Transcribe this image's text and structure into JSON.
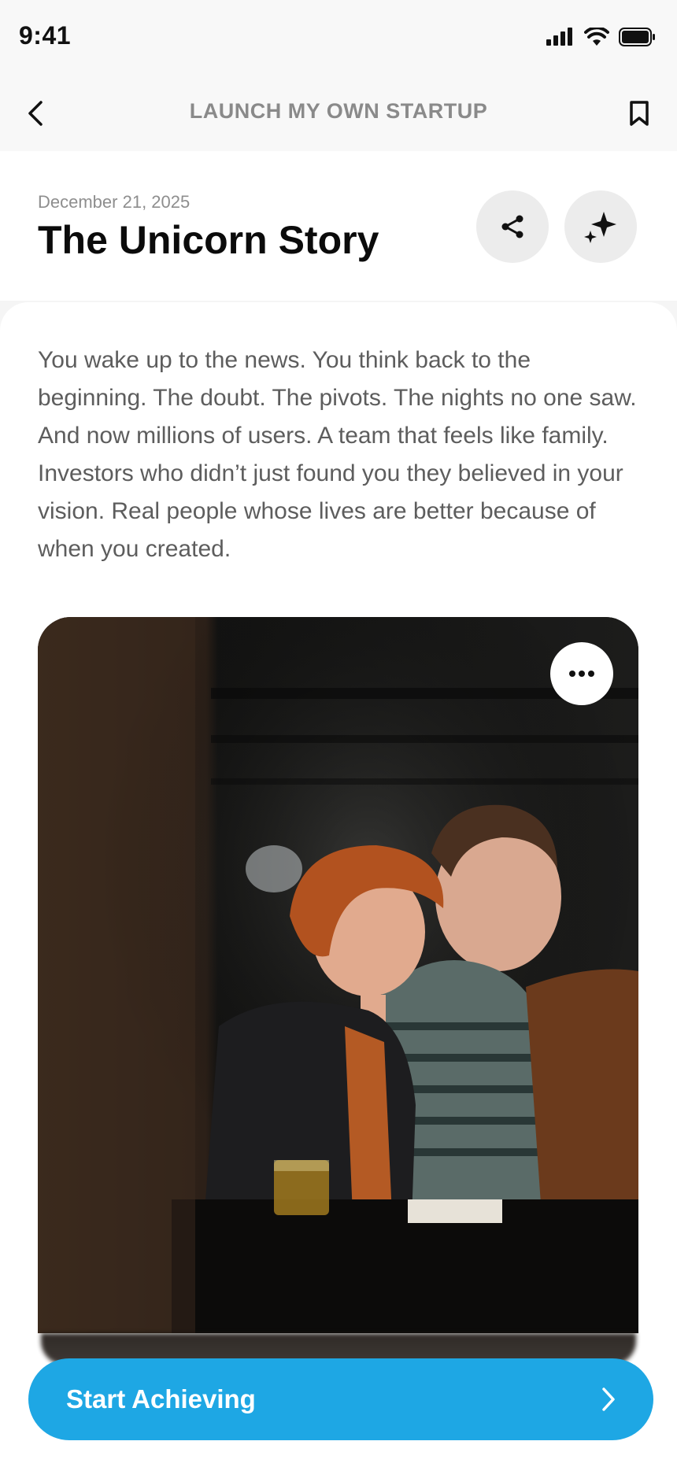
{
  "status_bar": {
    "time": "9:41",
    "icons": [
      "cellular-signal-icon",
      "wifi-icon",
      "battery-icon"
    ]
  },
  "nav": {
    "title": "LAUNCH MY OWN STARTUP",
    "back_icon": "chevron-left-icon",
    "bookmark_icon": "bookmark-icon"
  },
  "article": {
    "date": "December 21, 2025",
    "title": "The Unicorn Story",
    "actions": [
      "share-icon",
      "sparkle-icon"
    ],
    "body": "You wake up to the news. You think back to the beginning. The doubt. The pivots. The nights no one saw. And now millions of users. A team that feels like family. Investors who didn’t just found you they believed in your vision. Real people whose lives are better because of when you created.",
    "image_menu_icon": "more-horizontal-icon"
  },
  "cta": {
    "label": "Start Achieving",
    "icon": "chevron-right-icon"
  },
  "colors": {
    "accent": "#1ea7e4",
    "background": "#ffffff",
    "bar_background": "#f8f8f8"
  }
}
